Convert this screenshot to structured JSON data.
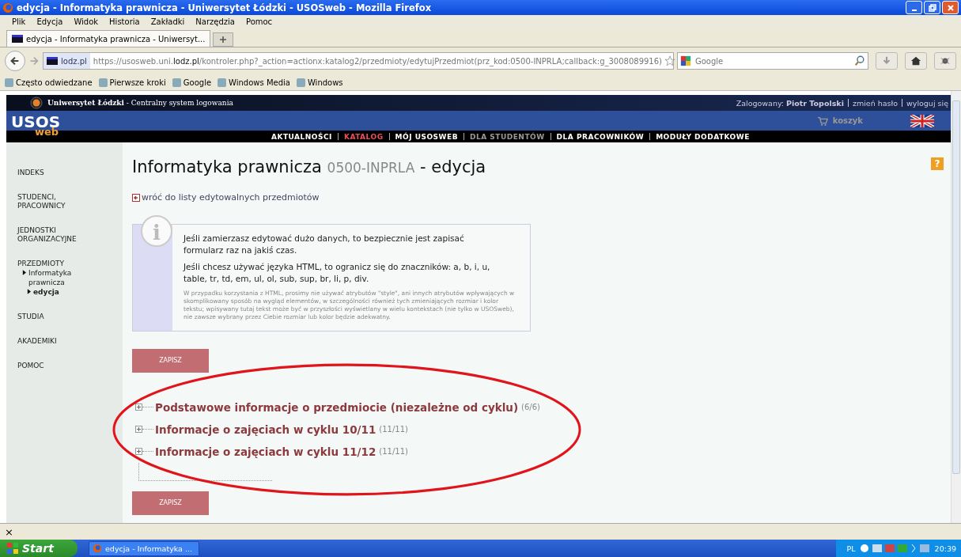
{
  "window": {
    "title": "edycja - Informatyka prawnicza - Uniwersytet Łódzki - USOSweb - Mozilla Firefox"
  },
  "menu": [
    "Plik",
    "Edycja",
    "Widok",
    "Historia",
    "Zakładki",
    "Narzędzia",
    "Pomoc"
  ],
  "tabs": [
    {
      "label": "edycja - Informatyka prawnicza - Uniwersyt...",
      "selected": true
    }
  ],
  "address": {
    "site": "lodz.pl",
    "url_prefix": "https://usosweb.uni.",
    "url_domain": "lodz.pl",
    "url_rest": "/kontroler.php?_action=actionx:katalog2/przedmioty/edytujPrzedmiot(prz_kod:0500-INPRLA;callback:g_3008089916)"
  },
  "search": {
    "placeholder": "Google"
  },
  "bookmarks": [
    "Często odwiedzane",
    "Pierwsze kroki",
    "Google",
    "Windows Media",
    "Windows"
  ],
  "site_header": {
    "university": "Uniwersytet Łódzki",
    "system": " - Centralny system logowania",
    "logged_label": "Zalogowany:",
    "user": "Piotr Topolski",
    "change_password": "zmień hasło",
    "logout": "wyloguj się",
    "logo_top": "USOS",
    "logo_bottom": "web",
    "cart": "koszyk"
  },
  "nav": [
    {
      "label": "AKTUALNOŚCI",
      "selected": false,
      "disabled": false
    },
    {
      "label": "KATALOG",
      "selected": true,
      "disabled": false
    },
    {
      "label": "MÓJ USOSWEB",
      "selected": false,
      "disabled": false
    },
    {
      "label": "DLA STUDENTÓW",
      "selected": false,
      "disabled": true
    },
    {
      "label": "DLA PRACOWNIKÓW",
      "selected": false,
      "disabled": false
    },
    {
      "label": "MODUŁY DODATKOWE",
      "selected": false,
      "disabled": false
    }
  ],
  "sidebar": {
    "items": [
      {
        "label": "INDEKS",
        "selected": false
      },
      {
        "label": "STUDENCI, PRACOWNICY",
        "selected": false
      },
      {
        "label": "JEDNOSTKI ORGANIZACYJNE",
        "selected": false
      },
      {
        "label": "PRZEDMIOTY",
        "selected": false,
        "children": [
          {
            "label": "Informatyka prawnicza",
            "selected": false,
            "children": [
              {
                "label": "edycja",
                "selected": true
              }
            ]
          }
        ]
      },
      {
        "label": "STUDIA",
        "selected": false
      },
      {
        "label": "AKADEMIKI",
        "selected": false
      },
      {
        "label": "POMOC",
        "selected": false
      }
    ]
  },
  "page": {
    "title": "Informatyka prawnicza",
    "code": "0500-INPRLA",
    "title_suffix": "- edycja",
    "help": "?",
    "back_link": "wróć do listy edytowalnych przedmiotów"
  },
  "info": {
    "icon": "i",
    "paragraphs": [
      "Jeśli zamierzasz edytować dużo danych, to bezpiecznie jest zapisać formularz raz na jakiś czas.",
      "Jeśli chcesz używać języka HTML, to ogranicz się do znaczników: a, b, i, u, table, tr, td, em, ul, ol, sub, sup, br, li, p, div."
    ],
    "note": "W przypadku korzystania z HTML, prosimy nie używać atrybutów \"style\", ani innych atrybutów wpływających w skomplikowany sposób na wygląd elementów, w szczególności również tych zmieniających rozmiar i kolor tekstu; wpisywany tutaj tekst może być w przyszłości wyświetlany w wielu kontekstach (nie tylko w USOSweb), nie zawsze wybrany przez Ciebie rozmiar lub kolor będzie adekwatny."
  },
  "save_buttons": [
    "ZAPISZ",
    "ZAPISZ"
  ],
  "sections": [
    {
      "title": "Podstawowe informacje o przedmiocie (niezależne od cyklu)",
      "count": "(6/6)",
      "expanded": false
    },
    {
      "title": "Informacje o zajęciach w cyklu 10/11",
      "count": "(11/11)",
      "expanded": false
    },
    {
      "title": "Informacje o zajęciach w cyklu 11/12",
      "count": "(11/11)",
      "expanded": false
    }
  ],
  "findbar": {
    "close": "×"
  },
  "taskbar": {
    "start": "Start",
    "windows": [
      "edycja - Informatyka ..."
    ],
    "language": "PL",
    "clock": "20:39"
  }
}
